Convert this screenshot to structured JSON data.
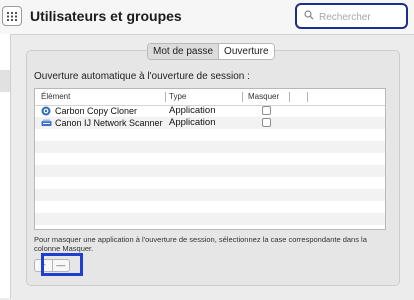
{
  "window": {
    "title": "Utilisateurs et groupes"
  },
  "search": {
    "placeholder": "Rechercher",
    "value": ""
  },
  "tabs": {
    "password": "Mot de passe",
    "login_items": "Ouverture",
    "selected": "Ouverture"
  },
  "login_items": {
    "heading": "Ouverture automatique à l'ouverture de session :",
    "columns": {
      "item": "Élément",
      "type": "Type",
      "hide": "Masquer"
    },
    "rows": [
      {
        "name": "Carbon Copy Cloner",
        "type": "Application",
        "hide": false,
        "icon": "carbon-copy-cloner-icon"
      },
      {
        "name": "Canon IJ Network Scanner",
        "type": "Application",
        "hide": false,
        "icon": "canon-scanner-icon"
      }
    ],
    "hint": "Pour masquer une application à l'ouverture de session, sélectionnez la case correspondante dans la colonne Masquer.",
    "add_label": "+",
    "remove_label": "—"
  },
  "colors": {
    "accent": "#1e3fcf",
    "search_border": "#1d2e8a"
  }
}
